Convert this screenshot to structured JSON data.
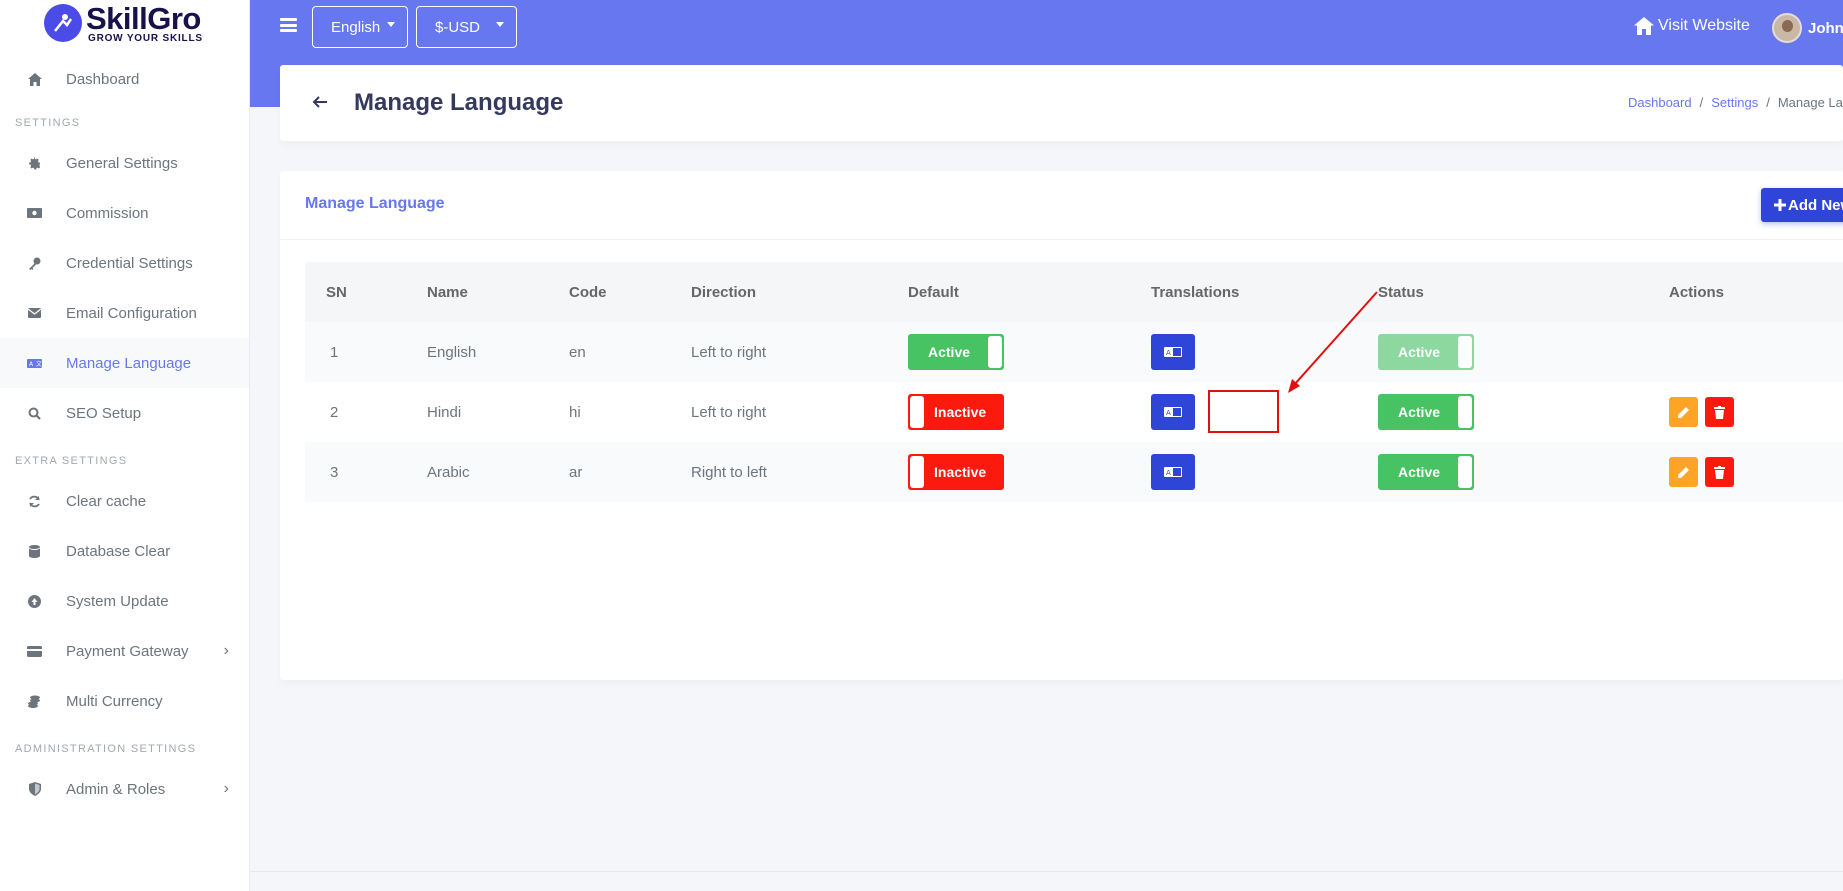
{
  "brand": {
    "name": "SkillGro",
    "tagline": "GROW YOUR SKILLS"
  },
  "sidebar": {
    "dashboard": "Dashboard",
    "heading_settings": "SETTINGS",
    "items_settings": [
      {
        "label": "General Settings",
        "icon": "gear-icon"
      },
      {
        "label": "Commission",
        "icon": "money-icon"
      },
      {
        "label": "Credential Settings",
        "icon": "key-icon"
      },
      {
        "label": "Email Configuration",
        "icon": "envelope-icon"
      },
      {
        "label": "Manage Language",
        "icon": "language-icon",
        "active": true
      },
      {
        "label": "SEO Setup",
        "icon": "search-icon"
      }
    ],
    "heading_extra": "EXTRA SETTINGS",
    "items_extra": [
      {
        "label": "Clear cache",
        "icon": "sync-icon"
      },
      {
        "label": "Database Clear",
        "icon": "database-icon"
      },
      {
        "label": "System Update",
        "icon": "upload-icon"
      },
      {
        "label": "Payment Gateway",
        "icon": "credit-card-icon"
      },
      {
        "label": "Multi Currency",
        "icon": "coins-icon"
      }
    ],
    "heading_admin": "ADMINISTRATION SETTINGS",
    "items_admin": [
      {
        "label": "Admin & Roles",
        "icon": "shield-icon"
      }
    ]
  },
  "header": {
    "language": "English",
    "currency": "$-USD",
    "visit_website": "Visit Website",
    "user_name": "John"
  },
  "page": {
    "title": "Manage Language",
    "breadcrumb": [
      "Dashboard",
      "Settings",
      "Manage Language"
    ]
  },
  "card": {
    "title": "Manage Language",
    "add_button": "Add New"
  },
  "table": {
    "columns": [
      "SN",
      "Name",
      "Code",
      "Direction",
      "Default",
      "Translations",
      "Status",
      "Actions"
    ],
    "rows": [
      {
        "sn": "1",
        "name": "English",
        "code": "en",
        "direction": "Left to right",
        "default": "Active",
        "status": "Active"
      },
      {
        "sn": "2",
        "name": "Hindi",
        "code": "hi",
        "direction": "Left to right",
        "default": "Inactive",
        "status": "Active"
      },
      {
        "sn": "3",
        "name": "Arabic",
        "code": "ar",
        "direction": "Right to left",
        "default": "Inactive",
        "status": "Active"
      }
    ]
  },
  "colors": {
    "primary": "#6777ef",
    "button_blue": "#2f45d8",
    "success": "#47c363",
    "danger": "#fc1a0e",
    "warning": "#ffa426",
    "annotation_red": "#e01010"
  }
}
